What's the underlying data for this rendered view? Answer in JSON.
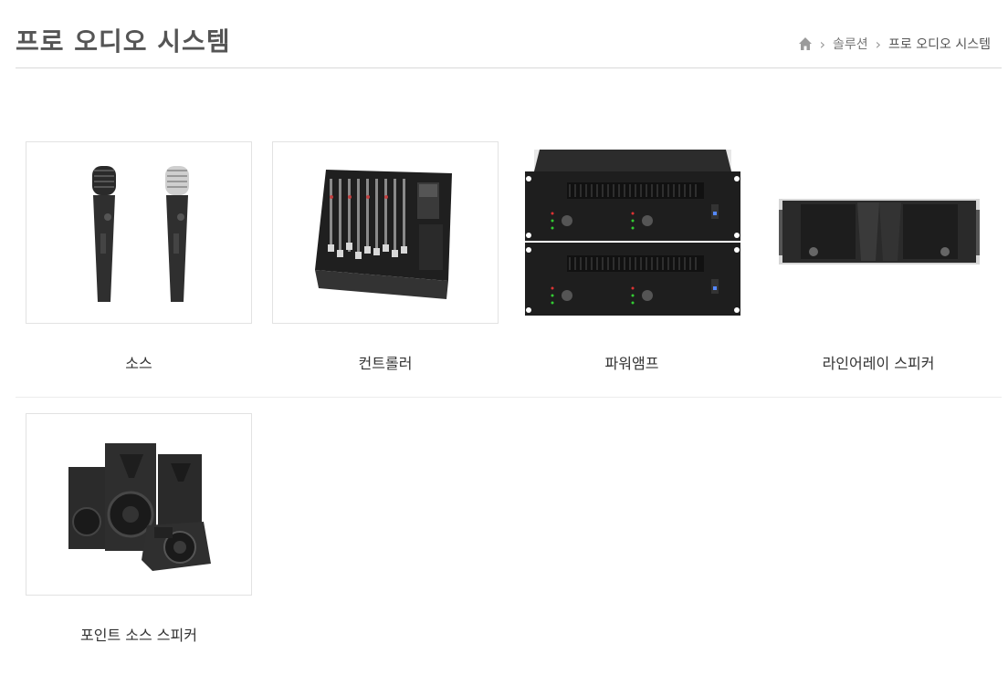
{
  "header": {
    "title": "프로 오디오 시스템",
    "breadcrumb": {
      "home_icon": "home-icon",
      "items": [
        "솔루션",
        "프로 오디오 시스템"
      ]
    }
  },
  "products": [
    {
      "label": "소스",
      "image": "microphones"
    },
    {
      "label": "컨트롤러",
      "image": "mixing-console"
    },
    {
      "label": "파워앰프",
      "image": "power-amplifiers"
    },
    {
      "label": "라인어레이 스피커",
      "image": "line-array-speaker"
    },
    {
      "label": "포인트 소스 스피커",
      "image": "point-source-speakers"
    }
  ]
}
